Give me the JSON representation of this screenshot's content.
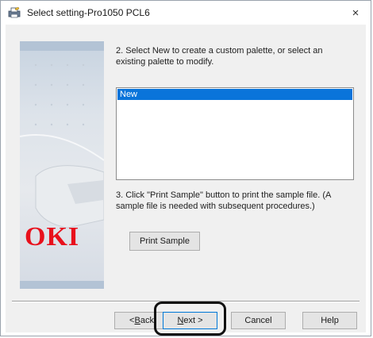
{
  "window": {
    "title": "Select setting-Pro1050 PCL6",
    "close_label": "×"
  },
  "brand": {
    "logo_text": "OKI",
    "logo_color": "#e8101c"
  },
  "steps": {
    "step2": "2. Select New to create a custom palette, or select an existing palette to modify.",
    "step3": "3. Click \"Print Sample\" button to print the sample file. (A sample file is needed with subsequent procedures.)"
  },
  "palette_list": {
    "items": [
      {
        "label": "New",
        "selected": true
      }
    ]
  },
  "buttons": {
    "print_sample": "Print Sample",
    "back_prefix": "< ",
    "back_accel": "B",
    "back_rest": "ack",
    "next_prefix": "",
    "next_accel": "N",
    "next_rest": "ext >",
    "cancel": "Cancel",
    "help": "Help"
  },
  "colors": {
    "selection": "#0a74da",
    "highlight_ring": "#111111"
  }
}
